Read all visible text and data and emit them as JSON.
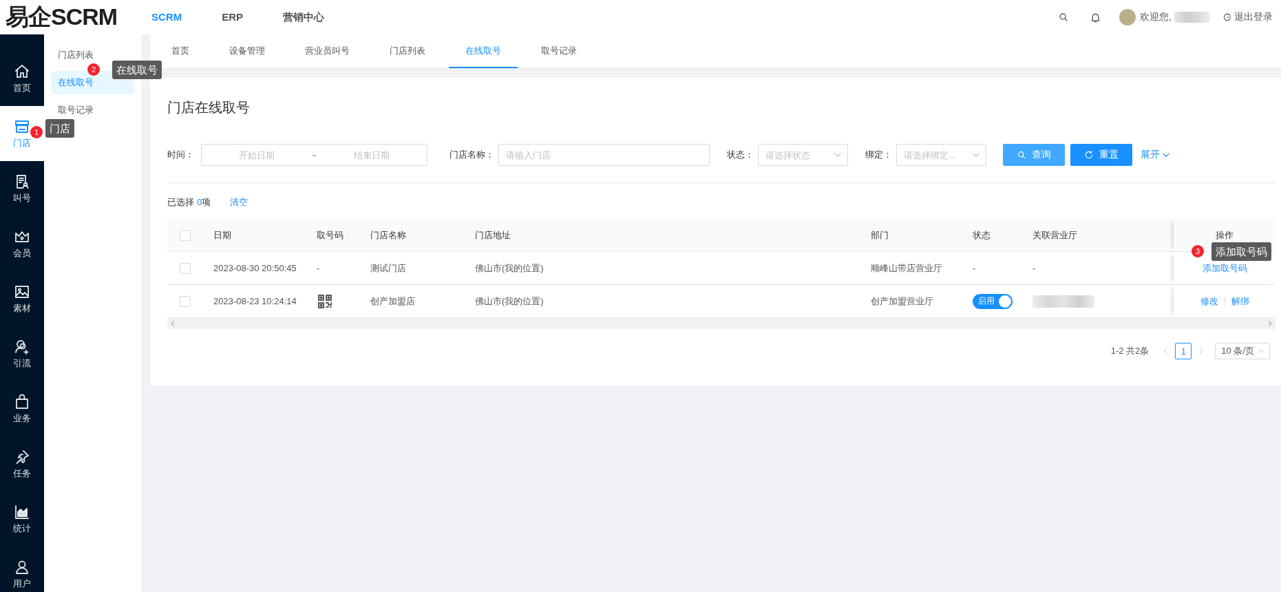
{
  "header": {
    "logo": "易企SCRM",
    "nav": [
      {
        "label": "SCRM",
        "selected": true
      },
      {
        "label": "ERP",
        "selected": false
      },
      {
        "label": "营销中心",
        "selected": false
      }
    ],
    "greeting": "欢迎您,",
    "logout": "退出登录"
  },
  "sidebar": {
    "items": [
      {
        "label": "首页",
        "selected": false
      },
      {
        "label": "门店",
        "selected": true
      },
      {
        "label": "叫号",
        "selected": false
      },
      {
        "label": "会员",
        "selected": false
      },
      {
        "label": "素材",
        "selected": false
      },
      {
        "label": "引流",
        "selected": false
      },
      {
        "label": "业务",
        "selected": false
      },
      {
        "label": "任务",
        "selected": false
      },
      {
        "label": "统计",
        "selected": false
      },
      {
        "label": "用户",
        "selected": false
      }
    ]
  },
  "submenu": {
    "items": [
      {
        "label": "门店列表",
        "selected": false
      },
      {
        "label": "在线取号",
        "selected": true
      },
      {
        "label": "取号记录",
        "selected": false
      }
    ]
  },
  "tabs": [
    {
      "label": "首页",
      "selected": false
    },
    {
      "label": "设备管理",
      "selected": false
    },
    {
      "label": "营业员叫号",
      "selected": false
    },
    {
      "label": "门店列表",
      "selected": false
    },
    {
      "label": "在线取号",
      "selected": true
    },
    {
      "label": "取号记录",
      "selected": false
    }
  ],
  "page": {
    "title": "门店在线取号"
  },
  "filters": {
    "time": {
      "label": "时间：",
      "start_placeholder": "开始日期",
      "separator": "~",
      "end_placeholder": "结束日期"
    },
    "store": {
      "label": "门店名称：",
      "placeholder": "请输入门店"
    },
    "status": {
      "label": "状态：",
      "placeholder": "请选择状态"
    },
    "binding": {
      "label": "绑定：",
      "placeholder": "请选择绑定..."
    },
    "buttons": [
      {
        "kind": "search",
        "label": "查询"
      },
      {
        "kind": "reset",
        "label": "重置"
      }
    ],
    "expand": "展开"
  },
  "selection": {
    "prefix": "已选择",
    "count": "0",
    "suffix": "项",
    "clear": "清空"
  },
  "table": {
    "select_all": false,
    "columns": [
      "日期",
      "取号码",
      "门店名称",
      "门店地址",
      "部门",
      "状态",
      "关联营业厅",
      "操作"
    ],
    "rows": [
      {
        "checked": false,
        "date": "2023-08-30 20:50:45",
        "code": {
          "kind": "text",
          "text": "-"
        },
        "store": "测试门店",
        "address": "佛山市(我的位置)",
        "department": "顺峰山带店营业厅",
        "status": {
          "kind": "text",
          "text": "-"
        },
        "hall": {
          "kind": "text",
          "text": "-"
        },
        "actions": [
          "添加取号码"
        ]
      },
      {
        "checked": false,
        "date": "2023-08-23 10:24:14",
        "code": {
          "kind": "qr"
        },
        "store": "创产加盟店",
        "address": "佛山市(我的位置)",
        "department": "创产加盟营业厅",
        "status": {
          "kind": "toggle",
          "label": "启用",
          "on": true
        },
        "hall": {
          "kind": "blurred"
        },
        "actions": [
          "修改",
          "解绑"
        ]
      }
    ]
  },
  "pagination": {
    "summary": "1-2 共2条",
    "pages": [
      {
        "label": "1",
        "selected": true
      }
    ],
    "page_size": "10 条/页"
  },
  "annotations": [
    {
      "number": "1",
      "text": "门店"
    },
    {
      "number": "2",
      "text": "在线取号"
    },
    {
      "number": "3",
      "text": "添加取号码"
    }
  ]
}
